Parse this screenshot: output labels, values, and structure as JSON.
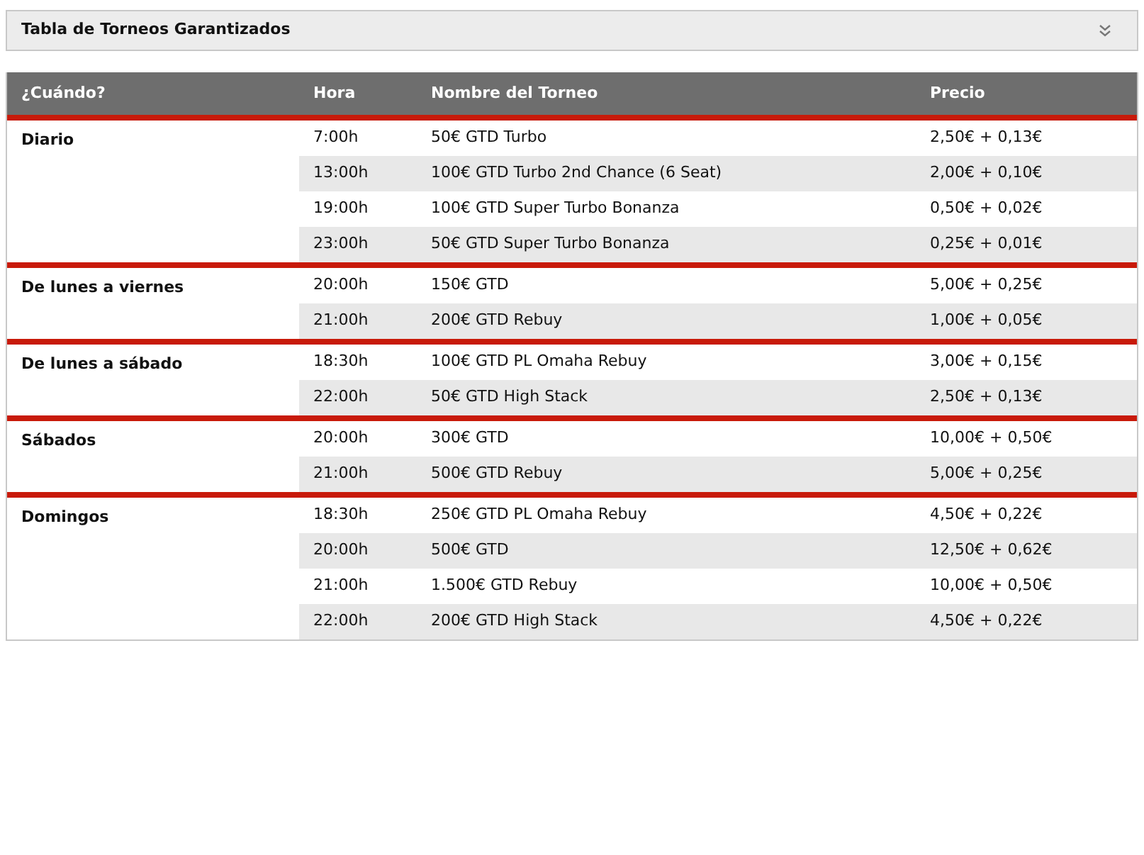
{
  "panel": {
    "title": "Tabla de Torneos Garantizados",
    "expanded": false
  },
  "table": {
    "columns": [
      "¿Cuándo?",
      "Hora",
      "Nombre del Torneo",
      "Precio"
    ],
    "groups": [
      {
        "day": "Diario",
        "rows": [
          {
            "time": "7:00h",
            "name": "50€ GTD Turbo",
            "price": "2,50€ + 0,13€"
          },
          {
            "time": "13:00h",
            "name": "100€ GTD Turbo 2nd Chance (6 Seat)",
            "price": "2,00€ + 0,10€"
          },
          {
            "time": "19:00h",
            "name": "100€ GTD Super Turbo Bonanza",
            "price": "0,50€ + 0,02€"
          },
          {
            "time": "23:00h",
            "name": "50€ GTD Super Turbo Bonanza",
            "price": "0,25€ + 0,01€"
          }
        ]
      },
      {
        "day": "De lunes a viernes",
        "rows": [
          {
            "time": "20:00h",
            "name": "150€ GTD",
            "price": "5,00€ + 0,25€"
          },
          {
            "time": "21:00h",
            "name": "200€ GTD Rebuy",
            "price": "1,00€ + 0,05€"
          }
        ]
      },
      {
        "day": "De lunes a sábado",
        "rows": [
          {
            "time": "18:30h",
            "name": "100€ GTD PL Omaha Rebuy",
            "price": "3,00€ + 0,15€"
          },
          {
            "time": "22:00h",
            "name": "50€ GTD High Stack",
            "price": "2,50€ + 0,13€"
          }
        ]
      },
      {
        "day": "Sábados",
        "rows": [
          {
            "time": "20:00h",
            "name": "300€ GTD",
            "price": "10,00€ + 0,50€"
          },
          {
            "time": "21:00h",
            "name": "500€ GTD Rebuy",
            "price": "5,00€ + 0,25€"
          }
        ]
      },
      {
        "day": "Domingos",
        "rows": [
          {
            "time": "18:30h",
            "name": "250€ GTD PL Omaha Rebuy",
            "price": "4,50€ + 0,22€"
          },
          {
            "time": "20:00h",
            "name": "500€ GTD",
            "price": "12,50€ + 0,62€"
          },
          {
            "time": "21:00h",
            "name": "1.500€ GTD Rebuy",
            "price": "10,00€ + 0,50€"
          },
          {
            "time": "22:00h",
            "name": "200€ GTD High Stack",
            "price": "4,50€ + 0,22€"
          }
        ]
      }
    ]
  }
}
